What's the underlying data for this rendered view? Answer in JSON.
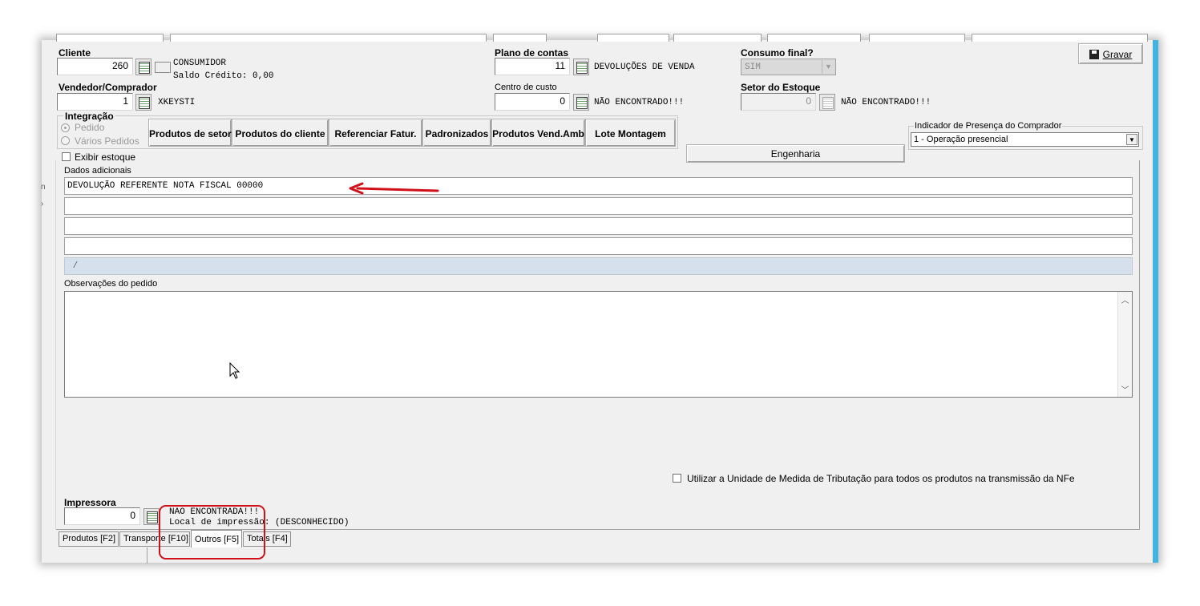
{
  "client": {
    "label": "Cliente",
    "code": "260",
    "name": "CONSUMIDOR",
    "credit": "Saldo Crédito: 0,00"
  },
  "vendor": {
    "label": "Vendedor/Comprador",
    "code": "1",
    "name": "XKEYSTI"
  },
  "plano": {
    "label": "Plano de contas",
    "code": "11",
    "name": "DEVOLUÇÕES DE VENDA"
  },
  "centro": {
    "label": "Centro de custo",
    "code": "0",
    "name": "NÃO ENCONTRADO!!!"
  },
  "consumo": {
    "label": "Consumo final?",
    "value": "SIM"
  },
  "setor": {
    "label": "Setor do Estoque",
    "code": "0",
    "name": "NÃO ENCONTRADO!!!"
  },
  "save_button": "Gravar",
  "integracao": {
    "label": "Integração",
    "option_pedido": "Pedido",
    "option_varios": "Vários Pedidos"
  },
  "buttons": {
    "produtos_setor": "Produtos de setor",
    "produtos_cliente": "Produtos do cliente",
    "referenciar": "Referenciar Fatur.",
    "padronizados": "Padronizados",
    "produtos_vend": "Produtos Vend.Amb",
    "lote": "Lote Montagem",
    "engenharia": "Engenharia"
  },
  "exibir_estoque": "Exibir estoque",
  "indicador": {
    "label": "Indicador de Presença do Comprador",
    "value": "1 - Operação presencial"
  },
  "dados": {
    "label": "Dados adicionais",
    "line1": "DEVOLUÇÃO REFERENTE NOTA FISCAL 00000",
    "line2": "",
    "line3": "",
    "line4": "",
    "line5": " /"
  },
  "observacoes_label": "Observações do pedido",
  "utilizar_unidade": "Utilizar a Unidade de Medida de Tributação para todos os produtos na transmissão da NFe",
  "impressora": {
    "label": "Impressora",
    "code": "0",
    "status": "NAO ENCONTRADA!!!",
    "local": "Local de impressão: (DESCONHECIDO)"
  },
  "tabs": [
    {
      "label": "Produtos [F2]"
    },
    {
      "label": "Transporte [F10]"
    },
    {
      "label": "Outros [F5]"
    },
    {
      "label": "Totais [F4]"
    }
  ],
  "colors": {
    "annotation_red": "#d0111b",
    "window_blue": "#41b4e0",
    "highlight_row": "#d6e0ec"
  }
}
